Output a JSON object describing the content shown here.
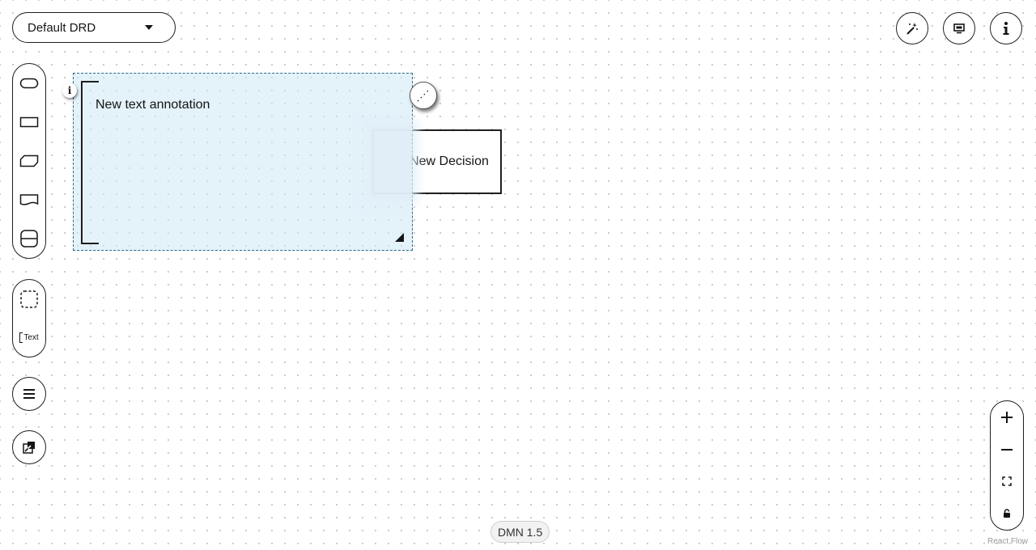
{
  "drd_selector": {
    "label": "Default DRD"
  },
  "toolbar": {
    "buttons": [
      {
        "icon": "magic-wand-icon"
      },
      {
        "icon": "monitor-icon"
      },
      {
        "icon": "info-icon"
      }
    ]
  },
  "palette": {
    "nodes": [
      "input-data-icon",
      "decision-icon",
      "bkm-icon",
      "knowledge-source-icon",
      "decision-service-icon"
    ],
    "secondary": [
      "group-icon",
      "text-annotation-icon"
    ],
    "secondary_text_label": "Text"
  },
  "diagram": {
    "annotation": {
      "text": "New text annotation"
    },
    "decision": {
      "text": "New Decision"
    }
  },
  "zoom": {
    "buttons": [
      "zoom-in-icon",
      "zoom-out-icon",
      "fit-view-icon",
      "lock-icon"
    ]
  },
  "footer": {
    "version_badge": "DMN 1.5",
    "attribution": "React Flow"
  },
  "colors": {
    "selection_fill": "#cde7f6",
    "selection_border": "#2b6a8e"
  }
}
